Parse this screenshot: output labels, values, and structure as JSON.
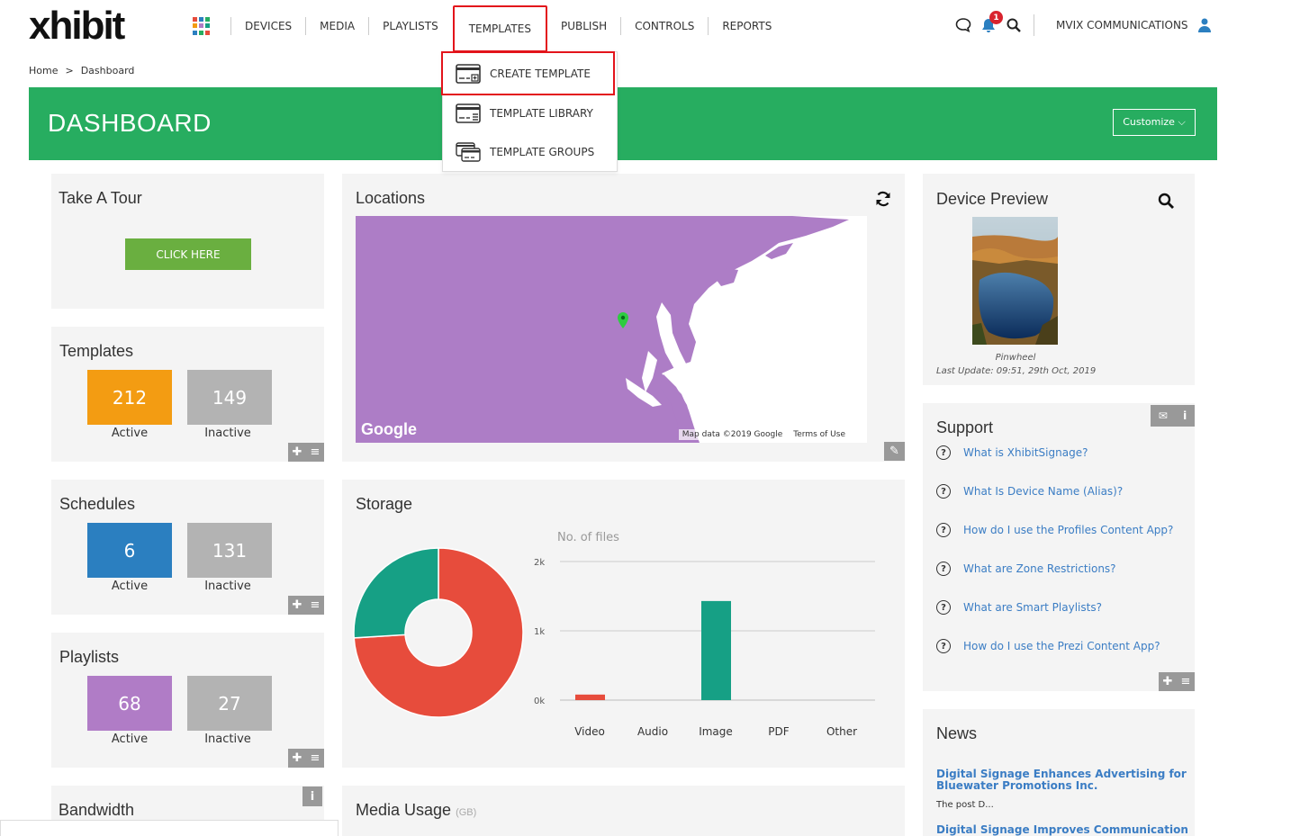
{
  "brand": {
    "logo_text": "xhibit",
    "accent": "#27ad60",
    "highlight_red": "#e3141b"
  },
  "nav": {
    "items": [
      "DEVICES",
      "MEDIA",
      "PLAYLISTS",
      "TEMPLATES",
      "PUBLISH",
      "CONTROLS",
      "REPORTS"
    ],
    "active": "TEMPLATES",
    "notification_count": "1",
    "company": "MVIX COMMUNICATIONS"
  },
  "dropdown": {
    "items": [
      "CREATE TEMPLATE",
      "TEMPLATE LIBRARY",
      "TEMPLATE GROUPS"
    ],
    "highlighted": "CREATE TEMPLATE"
  },
  "breadcrumb": {
    "home": "Home",
    "sep": ">",
    "current": "Dashboard"
  },
  "header": {
    "title": "DASHBOARD",
    "customize_label": "Customize ⌵"
  },
  "tour": {
    "title": "Take A Tour",
    "button": "CLICK HERE"
  },
  "templates": {
    "title": "Templates",
    "active_value": "212",
    "active_label": "Active",
    "inactive_value": "149",
    "inactive_label": "Inactive",
    "active_color": "#f39c12"
  },
  "schedules": {
    "title": "Schedules",
    "active_value": "6",
    "active_label": "Active",
    "inactive_value": "131",
    "inactive_label": "Inactive",
    "active_color": "#2b7fc0"
  },
  "playlists": {
    "title": "Playlists",
    "active_value": "68",
    "active_label": "Active",
    "inactive_value": "27",
    "inactive_label": "Inactive",
    "active_color": "#b07cc6"
  },
  "bandwidth": {
    "title": "Bandwidth"
  },
  "locations": {
    "title": "Locations",
    "google_label": "Google",
    "map_data": "Map data ©2019 Google",
    "terms": "Terms of Use"
  },
  "storage": {
    "title": "Storage",
    "chart_title": "No. of files"
  },
  "chart_data": [
    {
      "type": "pie",
      "labels": [
        "Image",
        "Video"
      ],
      "values": [
        74,
        26
      ],
      "colors": [
        "#e74c3c",
        "#16a085"
      ],
      "donut": true
    },
    {
      "type": "bar",
      "title": "No. of files",
      "categories": [
        "Video",
        "Audio",
        "Image",
        "PDF",
        "Other"
      ],
      "values": [
        80,
        0,
        1430,
        0,
        0
      ],
      "colors": [
        "#e74c3c",
        "#e74c3c",
        "#16a085",
        "#16a085",
        "#16a085"
      ],
      "yticks": [
        "0k",
        "1k",
        "2k"
      ],
      "ylim": [
        0,
        2000
      ],
      "grid": true
    }
  ],
  "media_usage": {
    "title": "Media Usage",
    "unit": "(GB)"
  },
  "device_preview": {
    "title": "Device Preview",
    "device_name": "Pinwheel",
    "last_update": "Last Update: 09:51, 29th Oct, 2019"
  },
  "support": {
    "title": "Support",
    "items": [
      "What is XhibitSignage?",
      "What Is Device Name (Alias)?",
      "How do I use the Profiles Content App?",
      "What are Zone Restrictions?",
      "What are Smart Playlists?",
      "How do I use the Prezi Content App?"
    ]
  },
  "news": {
    "title": "News",
    "item1_title": "Digital Signage Enhances Advertising for Bluewater Promotions Inc.",
    "item1_excerpt": "The post D...",
    "item2_title": "Digital Signage Improves Communication for"
  }
}
